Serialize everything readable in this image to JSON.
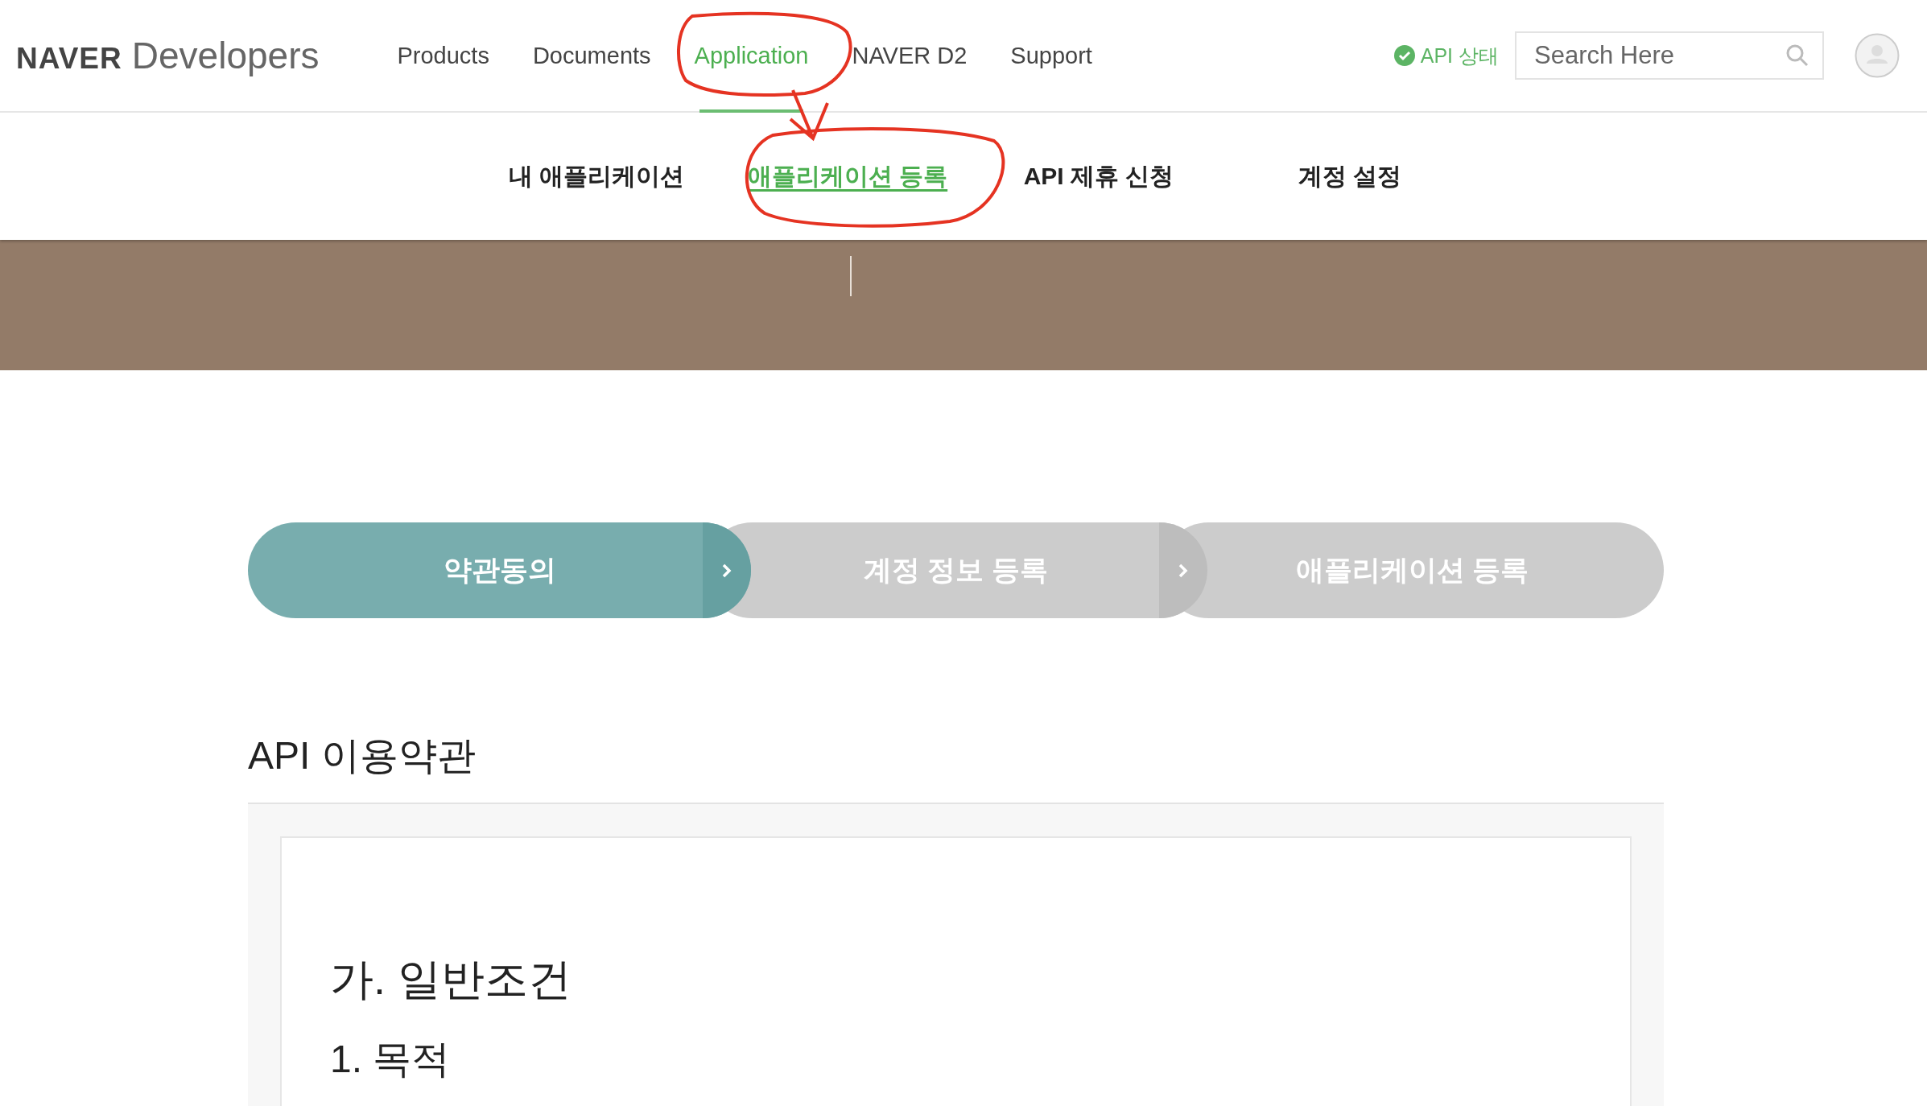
{
  "header": {
    "logo_bold": "NAVER",
    "logo_light": "Developers",
    "nav": [
      {
        "label": "Products",
        "selected": false
      },
      {
        "label": "Documents",
        "selected": false
      },
      {
        "label": "Application",
        "selected": true
      },
      {
        "label": "NAVER D2",
        "selected": false
      },
      {
        "label": "Support",
        "selected": false
      }
    ],
    "api_status": "API 상태",
    "search": {
      "placeholder": "Search Here"
    }
  },
  "sub_nav": [
    {
      "label": "내 애플리케이션",
      "selected": false
    },
    {
      "label": "애플리케이션 등록",
      "selected": true
    },
    {
      "label": "API 제휴 신청",
      "selected": false
    },
    {
      "label": "계정 설정",
      "selected": false
    }
  ],
  "steps": [
    {
      "label": "약관동의",
      "selected": true
    },
    {
      "label": "계정 정보 등록",
      "selected": false
    },
    {
      "label": "애플리케이션 등록",
      "selected": false
    }
  ],
  "terms": {
    "title": "API 이용약관",
    "heading": "가. 일반조건",
    "subheading": "1. 목적"
  }
}
